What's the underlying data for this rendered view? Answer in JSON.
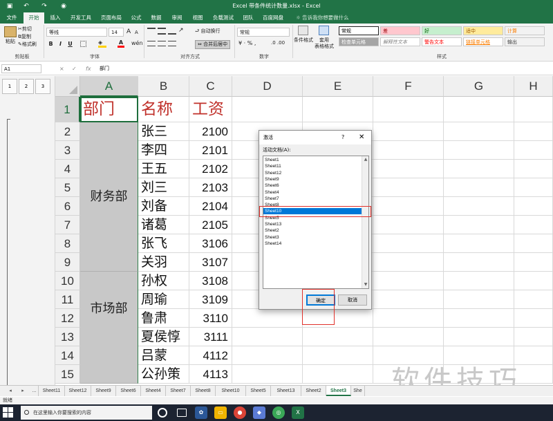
{
  "titlebar": {
    "title": "Excel 带条件统计数量.xlsx - Excel",
    "save_icon": "save-icon",
    "undo_icon": "undo-icon",
    "redo_icon": "redo-icon",
    "camera_icon": "camera-icon"
  },
  "ribbon_tabs": [
    "文件",
    "开始",
    "插入",
    "开发工具",
    "页面布局",
    "公式",
    "数据",
    "审阅",
    "视图",
    "负载测试",
    "团队",
    "百度网盘"
  ],
  "active_tab": "开始",
  "tell_me": "告诉我你想要做什么",
  "ribbon": {
    "paste": "粘贴",
    "cut": "剪切",
    "copy": "复制",
    "format_painter": "格式刷",
    "clipboard_label": "剪贴板",
    "font_name": "等线",
    "font_size": "14",
    "bold": "B",
    "italic": "I",
    "underline": "U",
    "font_label": "字体",
    "wrap_text": "自动换行",
    "merge_center": "合并后居中",
    "align_label": "对齐方式",
    "number_format": "常规",
    "number_label": "数字",
    "cond_format_1": "条件格式",
    "table_format_1": "套用",
    "table_format_2": "表格格式",
    "styles": [
      {
        "label": "常规",
        "bg": "#ffffff",
        "color": "#000000"
      },
      {
        "label": "差",
        "bg": "#ffc7ce",
        "color": "#9c0006"
      },
      {
        "label": "好",
        "bg": "#c6efce",
        "color": "#006100"
      },
      {
        "label": "适中",
        "bg": "#ffeb9c",
        "color": "#9c5700"
      },
      {
        "label": "计算",
        "bg": "#f2f2f2",
        "color": "#fa7d00"
      },
      {
        "label": "检查单元格",
        "bg": "#a5a5a5",
        "color": "#ffffff"
      },
      {
        "label": "解释性文本",
        "bg": "#ffffff",
        "color": "#7f7f7f"
      },
      {
        "label": "警告文本",
        "bg": "#ffffff",
        "color": "#ff0000"
      },
      {
        "label": "链接单元格",
        "bg": "#ffffff",
        "color": "#fa7d00"
      },
      {
        "label": "输出",
        "bg": "#f2f2f2",
        "color": "#3f3f3f"
      }
    ],
    "styles_label": "样式"
  },
  "formula_bar": {
    "name_box": "A1",
    "cancel": "×",
    "enter": "✓",
    "fx": "fx",
    "formula": "部门"
  },
  "outline_levels": [
    "1",
    "2",
    "3"
  ],
  "columns": [
    "A",
    "B",
    "C",
    "D",
    "E",
    "F",
    "G",
    "H"
  ],
  "rows": [
    "1",
    "2",
    "3",
    "4",
    "5",
    "6",
    "7",
    "8",
    "9",
    "10",
    "11",
    "12",
    "13",
    "14",
    "15"
  ],
  "headers": {
    "dept": "部门",
    "name": "名称",
    "salary": "工资"
  },
  "names": [
    "张三",
    "李四",
    "王五",
    "刘三",
    "刘备",
    "诸葛",
    "张飞",
    "关羽",
    "孙权",
    "周瑜",
    "鲁肃",
    "夏侯惇",
    "吕蒙",
    "公孙策"
  ],
  "salaries": [
    "2100",
    "2101",
    "2102",
    "2103",
    "2104",
    "2105",
    "3106",
    "3107",
    "3108",
    "3109",
    "3110",
    "3111",
    "4112",
    "4113"
  ],
  "departments": [
    "财务部",
    "市场部"
  ],
  "sheet_tabs": [
    "...",
    "Sheet11",
    "Sheet12",
    "Sheet9",
    "Sheet6",
    "Sheet4",
    "Sheet7",
    "Sheet8",
    "Sheet10",
    "Sheet5",
    "Sheet13",
    "Sheet2",
    "Sheet3",
    "She"
  ],
  "active_sheet": "Sheet3",
  "status": "就绪",
  "dialog": {
    "title": "激活",
    "help": "?",
    "close": "✕",
    "label": "活动文档(A):",
    "items": [
      "Sheet1",
      "Sheet11",
      "Sheet12",
      "Sheet9",
      "Sheet6",
      "Sheet4",
      "Sheet7",
      "Sheet8",
      "Sheet10",
      "Sheet5",
      "Sheet13",
      "Sheet2",
      "Sheet3",
      "Sheet14"
    ],
    "selected": "Sheet10",
    "ok": "确定",
    "cancel": "取消"
  },
  "taskbar": {
    "search_placeholder": "在这里输入你要搜索的内容",
    "apps": [
      "cortana-icon",
      "task-view-icon",
      "photos-icon",
      "folder-icon",
      "chrome-icon",
      "app-icon",
      "app2-icon",
      "excel-icon"
    ]
  },
  "watermark": "软件技巧"
}
